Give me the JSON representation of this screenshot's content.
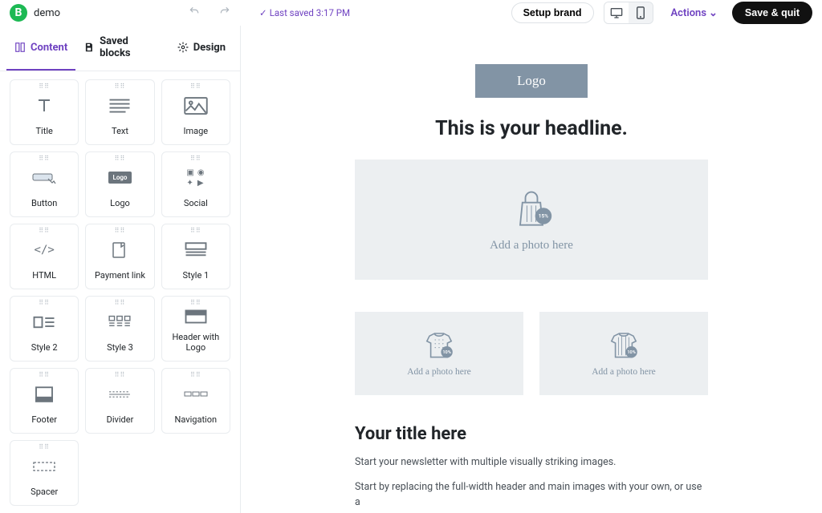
{
  "header": {
    "brand_letter": "B",
    "doc_name": "demo",
    "last_saved": "Last saved 3:17 PM",
    "setup_brand": "Setup brand",
    "actions": "Actions",
    "save_quit": "Save & quit"
  },
  "tabs": {
    "content": "Content",
    "saved_blocks": "Saved blocks",
    "design": "Design"
  },
  "blocks": [
    {
      "label": "Title"
    },
    {
      "label": "Text"
    },
    {
      "label": "Image"
    },
    {
      "label": "Button"
    },
    {
      "label": "Logo"
    },
    {
      "label": "Social"
    },
    {
      "label": "HTML"
    },
    {
      "label": "Payment link"
    },
    {
      "label": "Style 1"
    },
    {
      "label": "Style 2"
    },
    {
      "label": "Style 3"
    },
    {
      "label": "Header with Logo"
    },
    {
      "label": "Footer"
    },
    {
      "label": "Divider"
    },
    {
      "label": "Navigation"
    },
    {
      "label": "Spacer"
    }
  ],
  "email": {
    "logo": "Logo",
    "headline": "This is your headline.",
    "photo_large": "Add a photo here",
    "photo_small_1": "Add a photo here",
    "photo_small_2": "Add a photo here",
    "badge_large": "15%",
    "badge_small": "10%",
    "title": "Your title here",
    "p1": "Start your newsletter with multiple visually striking images.",
    "p2": "Start by replacing the full-width header and main images with your own, or use a"
  }
}
